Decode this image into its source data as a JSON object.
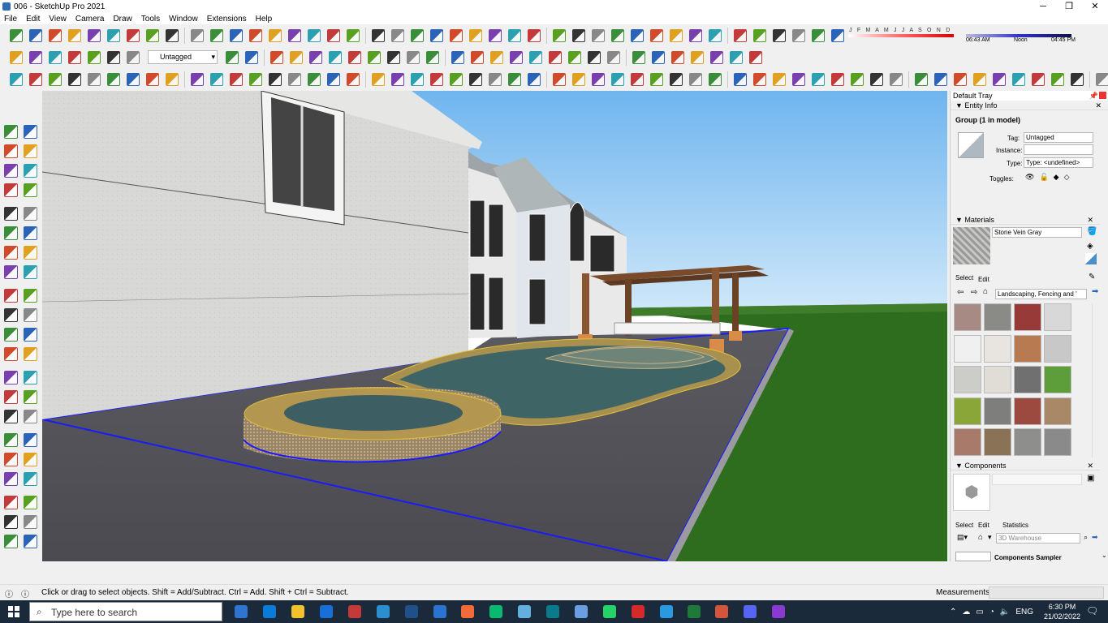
{
  "window": {
    "title": "006 - SketchUp Pro 2021",
    "minimize": "─",
    "maximize": "❐",
    "close": "✕"
  },
  "menu": [
    "File",
    "Edit",
    "View",
    "Camera",
    "Draw",
    "Tools",
    "Window",
    "Extensions",
    "Help"
  ],
  "toolbar": {
    "tag_select_value": "Untagged"
  },
  "shadow": {
    "months": "J F M A M J J A S O N D",
    "time_start": "06:43 AM",
    "time_mid": "Noon",
    "time_end": "04:45 PM"
  },
  "tray": {
    "title": "Default Tray",
    "entity_info": {
      "header": "Entity Info",
      "selection": "Group (1 in model)",
      "tag_label": "Tag:",
      "tag_value": "Untagged",
      "instance_label": "Instance:",
      "instance_value": "",
      "type_label": "Type:",
      "type_value": "Type: <undefined>",
      "toggles_label": "Toggles:"
    },
    "materials": {
      "header": "Materials",
      "current_name": "Stone Vein Gray",
      "tab_select": "Select",
      "tab_edit": "Edit",
      "library": "Landscaping, Fencing and '",
      "swatch_colors": [
        "#a88a84",
        "#8a8a86",
        "#983a38",
        "#d8d8d8",
        "#f0f0f0",
        "#e8e4e0",
        "#b87a50",
        "#c8c8c8",
        "#ccccc8",
        "#e0dcd6",
        "#707070",
        "#5e9e3a",
        "#8aa638",
        "#7e7e7c",
        "#9c4a40",
        "#a88866",
        "#a87a6a",
        "#8a7256",
        "#8e8e8c",
        "#8a8a8a"
      ]
    },
    "components": {
      "header": "Components",
      "tab_select": "Select",
      "tab_edit": "Edit",
      "tab_statistics": "Statistics",
      "search_placeholder": "3D Warehouse",
      "sampler": "Components Sampler"
    }
  },
  "status": {
    "hint": "Click or drag to select objects. Shift = Add/Subtract. Ctrl = Add. Shift + Ctrl = Subtract.",
    "measurements_label": "Measurements",
    "measurements_value": ""
  },
  "taskbar": {
    "search_placeholder": "Type here to search",
    "language": "ENG",
    "time": "6:30 PM",
    "date": "21/02/2022"
  },
  "colors": {
    "sky": "#8ec8f2",
    "grass": "#2d6b1c",
    "patio": "#56565c",
    "water": "#3e6466",
    "pool_coping": "#b89a56",
    "selection": "#0000ff"
  }
}
